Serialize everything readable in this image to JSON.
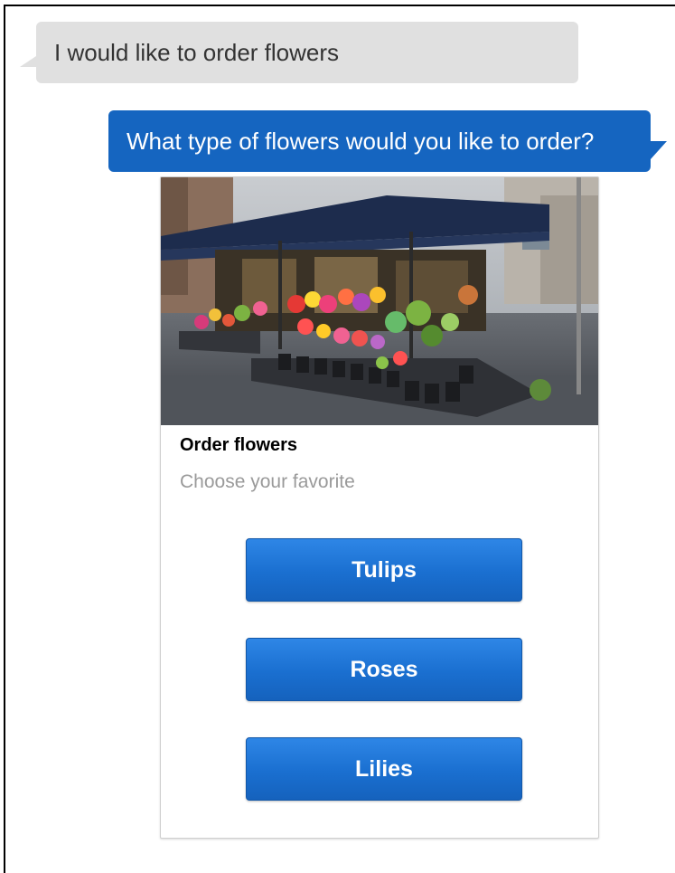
{
  "messages": {
    "user_text": "I would like to order flowers",
    "bot_text": "What type of flowers would you like to order?"
  },
  "card": {
    "image_label": "flower-stall-photo",
    "title": "Order flowers",
    "subtitle": "Choose your favorite",
    "buttons": [
      {
        "label": "Tulips"
      },
      {
        "label": "Roses"
      },
      {
        "label": "Lilies"
      }
    ]
  },
  "colors": {
    "bot_bubble": "#1565c0",
    "user_bubble": "#e0e0e0",
    "button": "#1a6fd0",
    "subtitle": "#9a9a9a"
  }
}
